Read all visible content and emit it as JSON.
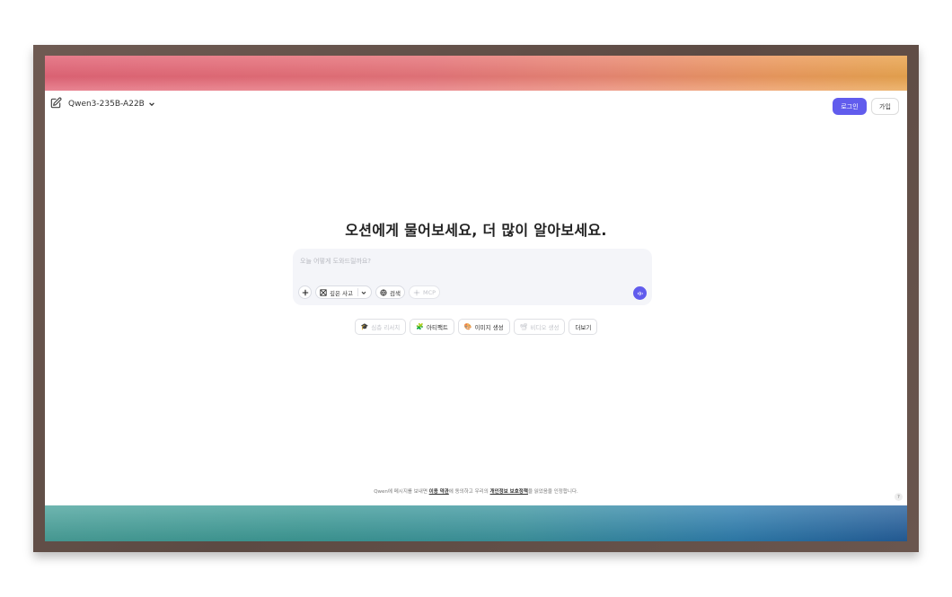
{
  "header": {
    "model_name": "Qwen3-235B-A22B",
    "login_label": "로그인",
    "signup_label": "가입"
  },
  "main": {
    "headline": "오션에게 물어보세요, 더 많이 알아보세요.",
    "input_placeholder": "오늘 어떻게 도와드릴까요?",
    "tools": {
      "thinking_label": "깊은 사고",
      "search_label": "검색",
      "mcp_label": "MCP"
    },
    "suggestions": [
      {
        "icon": "🎓",
        "label": "심층 리서치",
        "disabled": true
      },
      {
        "icon": "🧩",
        "label": "아티팩트",
        "disabled": false
      },
      {
        "icon": "🎨",
        "label": "이미지 생성",
        "disabled": false
      },
      {
        "icon": "📽",
        "label": "비디오 생성",
        "disabled": true
      },
      {
        "icon": "",
        "label": "더보기",
        "disabled": false
      }
    ]
  },
  "footer": {
    "prefix": "Qwen에 메시지를 보내면 ",
    "terms_label": "이용 약관",
    "middle": "에 동의하고 우리의 ",
    "privacy_label": "개인정보 보호정책",
    "suffix": "을 읽었음을 인정합니다.",
    "help_label": "?"
  },
  "colors": {
    "accent": "#615ced",
    "frame": "#5c4a43"
  }
}
